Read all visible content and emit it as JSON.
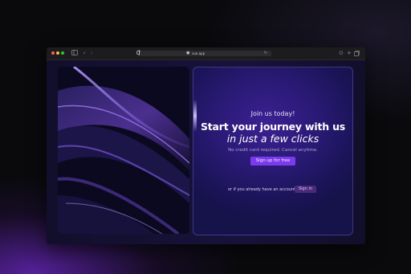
{
  "browser": {
    "url": "vue.app",
    "colors": {
      "close": "#ff5f57",
      "minimize": "#febc2e",
      "zoom": "#28c840"
    },
    "icons": [
      "sidebar-icon",
      "back-icon",
      "forward-icon",
      "shield-icon",
      "lock-icon",
      "reload-icon",
      "download-icon",
      "new-tab-icon",
      "tabs-overview-icon"
    ]
  },
  "hero": {
    "eyebrow": "Join us today!",
    "headline_line1": "Start your journey with us",
    "headline_line2": "in just a few clicks",
    "subtext": "No credit card required. Cancel anytime.",
    "cta_label": "Sign up for free",
    "signin_prompt": "or if you already have an account",
    "signin_label": "Sign in"
  },
  "colors": {
    "accent": "#7c3aed",
    "panel": "#2a1a76",
    "signin_button": "#4a2a7a"
  }
}
